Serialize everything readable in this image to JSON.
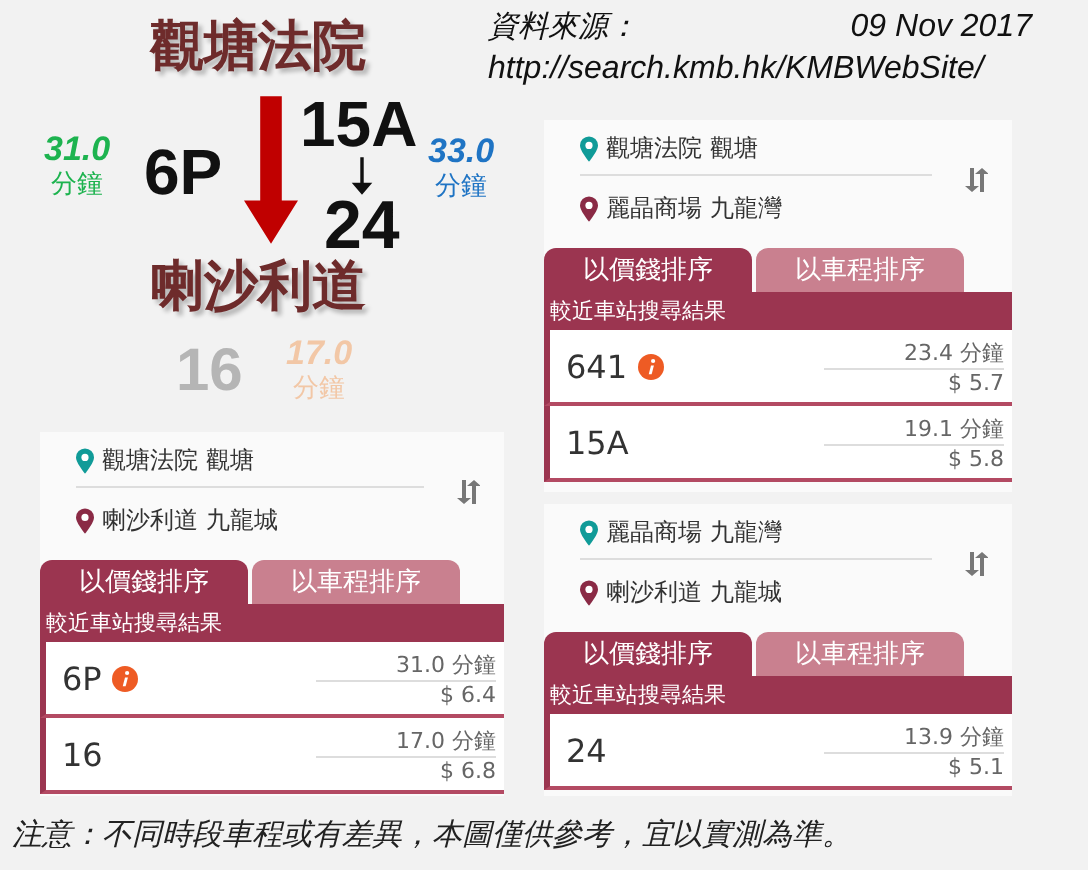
{
  "diagram": {
    "from": "觀塘法院",
    "to": "喇沙利道",
    "options": [
      {
        "kind": "direct",
        "routes": [
          "6P"
        ],
        "time": "31.0",
        "unit": "分鐘",
        "color": "#1db34f",
        "faded": false
      },
      {
        "kind": "transfer",
        "routes": [
          "15A",
          "24"
        ],
        "time": "33.0",
        "unit": "分鐘",
        "color": "#1f74c4",
        "faded": false
      },
      {
        "kind": "direct",
        "routes": [
          "16"
        ],
        "time": "17.0",
        "unit": "分鐘",
        "color": "#f2c7a6",
        "faded": true
      }
    ]
  },
  "source": {
    "label": "資料來源：",
    "date": "09 Nov 2017",
    "url": "http://search.kmb.hk/KMBWebSite/"
  },
  "panels": [
    {
      "from": "觀塘法院 觀塘",
      "to": "喇沙利道 九龍城",
      "tabs": [
        {
          "label": "以價錢排序",
          "selected": true
        },
        {
          "label": "以車程排序",
          "selected": false
        }
      ],
      "results_title": "較近車站搜尋結果",
      "results": [
        {
          "route": "6P",
          "info": true,
          "time": "31.0 分鐘",
          "fare": "$ 6.4"
        },
        {
          "route": "16",
          "info": false,
          "time": "17.0 分鐘",
          "fare": "$ 6.8"
        }
      ]
    },
    {
      "from": "觀塘法院 觀塘",
      "to": "麗晶商場 九龍灣",
      "tabs": [
        {
          "label": "以價錢排序",
          "selected": true
        },
        {
          "label": "以車程排序",
          "selected": false
        }
      ],
      "results_title": "較近車站搜尋結果",
      "results": [
        {
          "route": "641",
          "info": true,
          "time": "23.4 分鐘",
          "fare": "$ 5.7"
        },
        {
          "route": "15A",
          "info": false,
          "time": "19.1 分鐘",
          "fare": "$ 5.8"
        }
      ]
    },
    {
      "from": "麗晶商場 九龍灣",
      "to": "喇沙利道 九龍城",
      "tabs": [
        {
          "label": "以價錢排序",
          "selected": true
        },
        {
          "label": "以車程排序",
          "selected": false
        }
      ],
      "results_title": "較近車站搜尋結果",
      "results": [
        {
          "route": "24",
          "info": false,
          "time": "13.9 分鐘",
          "fare": "$ 5.1"
        }
      ]
    }
  ],
  "note": "注意：不同時段車程或有差異，本圖僅供參考，宜以實測為準。"
}
